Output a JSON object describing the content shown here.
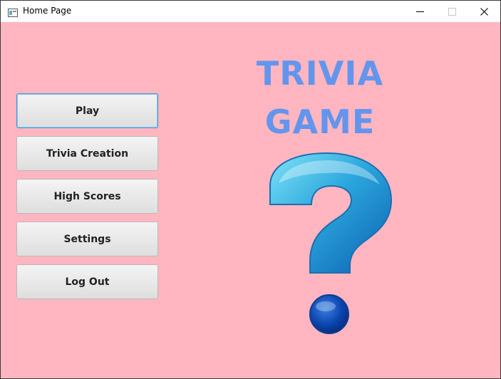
{
  "window": {
    "title": "Home Page",
    "controls": {
      "minimize_icon": "minimize-icon",
      "maximize_icon": "maximize-icon",
      "close_icon": "close-icon"
    }
  },
  "menu": {
    "buttons": [
      {
        "label": "Play"
      },
      {
        "label": "Trivia Creation"
      },
      {
        "label": "High Scores"
      },
      {
        "label": "Settings"
      },
      {
        "label": "Log Out"
      }
    ],
    "focused_index": 0
  },
  "hero": {
    "title_line1": "TRIVIA",
    "title_line2": "GAME",
    "image_icon": "question-mark-icon"
  },
  "colors": {
    "background": "#ffb6c1",
    "title": "#6495ed",
    "focus_border": "#3a9ad9"
  }
}
